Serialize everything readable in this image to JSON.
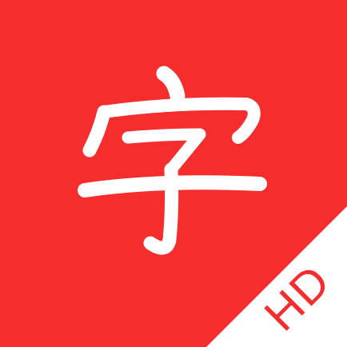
{
  "app_icon": {
    "character": "字",
    "badge_text": "HD",
    "colors": {
      "background": "#f52d2d",
      "glyph": "#ffffff",
      "corner": "#ffffff",
      "badge_text": "#f52d2d"
    },
    "glyph_style": "brush calligraphy"
  }
}
